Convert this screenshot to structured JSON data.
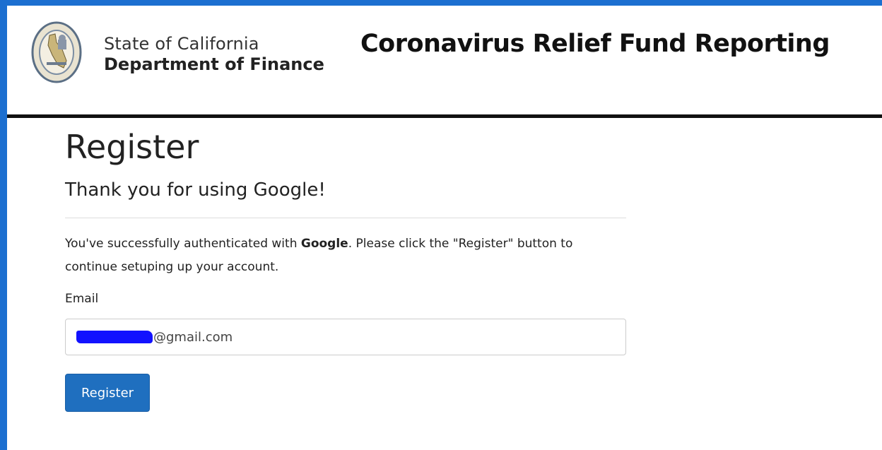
{
  "header": {
    "agency_state": "State of California",
    "agency_department": "Department of Finance",
    "site_title": "Coronavirus Relief Fund Reporting"
  },
  "main": {
    "page_title": "Register",
    "subtitle": "Thank you for using Google!",
    "message_part1": "You've successfully authenticated with ",
    "message_provider": "Google",
    "message_part2": ". Please click the \"Register\" button to continue setuping up your account.",
    "email_label": "Email",
    "email_value": "@gmail.com",
    "register_label": "Register"
  },
  "colors": {
    "frame_border": "#1c6fd0",
    "primary_button": "#1f6fbf",
    "header_rule": "#111111",
    "redaction": "#1212ff"
  }
}
